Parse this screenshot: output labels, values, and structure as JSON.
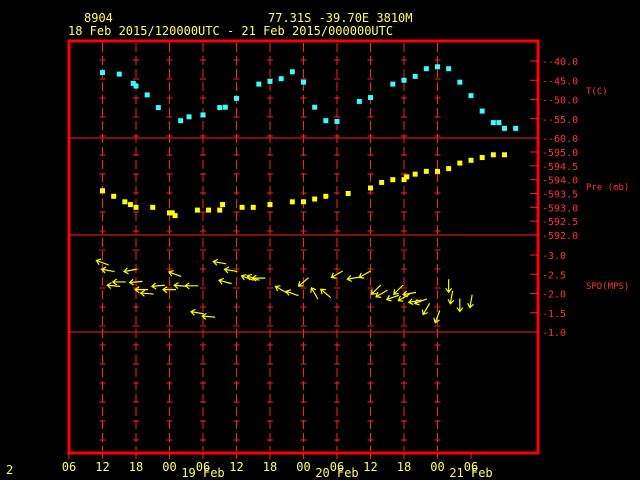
{
  "header": {
    "station": "8904",
    "location": "77.31S   -39.70E   3810M",
    "period": "18 Feb 2015/120000UTC - 21 Feb 2015/000000UTC"
  },
  "footer": {
    "page_number": "2"
  },
  "colors": {
    "frame": "#ff0000",
    "grid": "#ff2020",
    "temp": "#33ffff",
    "pressure": "#ffff00",
    "wind": "#ffff00",
    "text": "#ffff66"
  },
  "chart_data": [
    {
      "type": "scatter",
      "panel": "temperature",
      "ylabel": "T(C)",
      "ylim": [
        -60.0,
        -37.5
      ],
      "yticks": [
        "-40.0",
        "-45.0",
        "-50.0",
        "-55.0",
        "-60.0"
      ],
      "ytick_values": [
        -40,
        -45,
        -50,
        -55,
        -60
      ],
      "x_hours": [
        0,
        3,
        5.5,
        6,
        8,
        10,
        14,
        15.5,
        18,
        21,
        22,
        24,
        28,
        30,
        32,
        34,
        36,
        38,
        40,
        42,
        46,
        48,
        52,
        54,
        56,
        58,
        60,
        62,
        64,
        66,
        68,
        70,
        71,
        72,
        74
      ],
      "values": [
        -43.0,
        -43.4,
        -45.8,
        -46.5,
        -48.8,
        -52.1,
        -55.5,
        -54.5,
        -54.0,
        -52.1,
        -52.0,
        -49.7,
        -46.0,
        -45.3,
        -44.6,
        -42.8,
        -45.5,
        -52.0,
        -55.5,
        -55.7,
        -50.5,
        -49.5,
        -46.0,
        -45.0,
        -44.0,
        -42.0,
        -41.5,
        -42.0,
        -45.5,
        -49.0,
        -53.0,
        -56.0,
        -56.0,
        -57.5,
        -57.5
      ]
    },
    {
      "type": "scatter",
      "panel": "pressure",
      "ylabel": "Pre (mb)",
      "ylim": [
        592.0,
        595.2
      ],
      "yticks": [
        "595.0",
        "594.5",
        "594.0",
        "593.5",
        "593.0",
        "592.5",
        "592.0"
      ],
      "ytick_values": [
        595.0,
        594.5,
        594.0,
        593.5,
        593.0,
        592.5,
        592.0
      ],
      "x_hours": [
        0,
        2,
        4,
        5,
        6,
        9,
        12,
        12.5,
        13,
        17,
        19,
        21,
        21.5,
        25,
        27,
        30,
        34,
        36,
        38,
        40,
        44,
        48,
        50,
        52,
        54,
        54.5,
        56,
        58,
        60,
        62,
        64,
        66,
        68,
        70,
        72
      ],
      "values": [
        593.6,
        593.4,
        593.2,
        593.1,
        593.0,
        593.0,
        592.8,
        592.8,
        592.7,
        592.9,
        592.9,
        592.9,
        593.1,
        593.0,
        593.0,
        593.1,
        593.2,
        593.2,
        593.3,
        593.4,
        593.5,
        593.7,
        593.9,
        594.0,
        594.0,
        594.1,
        594.2,
        594.3,
        594.3,
        594.4,
        594.6,
        594.7,
        594.8,
        594.9,
        594.9
      ]
    },
    {
      "type": "scatter",
      "panel": "wind",
      "ylabel": "SPD(MPS)",
      "ylim": [
        0.9,
        3.1
      ],
      "yticks": [
        "3.0",
        "2.5",
        "2.0",
        "1.5",
        "1.0"
      ],
      "ytick_values": [
        3.0,
        2.5,
        2.0,
        1.5,
        1.0
      ],
      "x_hours": [
        0,
        1,
        2,
        3,
        5,
        6,
        7,
        8,
        10,
        12,
        13,
        14,
        16,
        17,
        19,
        21,
        22,
        23,
        26,
        27,
        28,
        32,
        34,
        36,
        38,
        40,
        42,
        45,
        47,
        49,
        50,
        52,
        53,
        54,
        55,
        56,
        57,
        58,
        60,
        62,
        62.5,
        64,
        66
      ],
      "values": [
        2.8,
        2.6,
        2.2,
        2.3,
        2.6,
        2.3,
        2.1,
        2.0,
        2.2,
        2.1,
        2.5,
        2.2,
        2.2,
        1.5,
        1.4,
        2.8,
        2.3,
        2.6,
        2.4,
        2.4,
        2.4,
        2.1,
        2.0,
        2.3,
        2.0,
        2.0,
        2.5,
        2.4,
        2.5,
        2.1,
        2.0,
        1.9,
        2.1,
        1.9,
        2.0,
        1.8,
        1.8,
        1.6,
        1.4,
        2.2,
        1.9,
        1.7,
        1.8
      ],
      "directions_deg": [
        110,
        100,
        95,
        90,
        80,
        85,
        90,
        95,
        85,
        90,
        110,
        95,
        90,
        100,
        95,
        100,
        105,
        100,
        110,
        110,
        90,
        120,
        110,
        50,
        150,
        130,
        60,
        80,
        60,
        45,
        60,
        70,
        45,
        60,
        80,
        80,
        70,
        30,
        20,
        0,
        10,
        0,
        10
      ]
    }
  ],
  "xaxis": {
    "xlim_hours": [
      -6,
      78
    ],
    "tick_labels": [
      "06",
      "12",
      "18",
      "00",
      "06",
      "12",
      "18",
      "00",
      "06",
      "12",
      "18",
      "00",
      "06"
    ],
    "day_labels": [
      "19 Feb",
      "20 Feb",
      "21 Feb"
    ]
  }
}
